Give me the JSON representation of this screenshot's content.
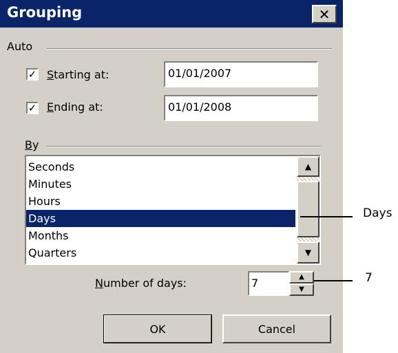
{
  "dialog": {
    "title": "Grouping",
    "close_glyph": "✕"
  },
  "auto": {
    "label": "Auto",
    "starting": {
      "checked": true,
      "label_accel": "S",
      "label_rest": "tarting at:",
      "value": "01/01/2007"
    },
    "ending": {
      "checked": true,
      "label_accel": "E",
      "label_rest": "nding at:",
      "value": "01/01/2008"
    }
  },
  "by": {
    "label_accel": "B",
    "label_rest": "y",
    "items": [
      "Seconds",
      "Minutes",
      "Hours",
      "Days",
      "Months",
      "Quarters"
    ],
    "selected": "Days"
  },
  "number_of_days": {
    "label_accel": "N",
    "label_rest": "umber of days:",
    "value": "7"
  },
  "buttons": {
    "ok": "OK",
    "cancel": "Cancel"
  },
  "callouts": {
    "selection": "Days",
    "number": "7"
  },
  "icons": {
    "check": "check-icon",
    "close": "close-icon",
    "scroll_up": "arrow-up-icon",
    "scroll_down": "arrow-down-icon"
  }
}
